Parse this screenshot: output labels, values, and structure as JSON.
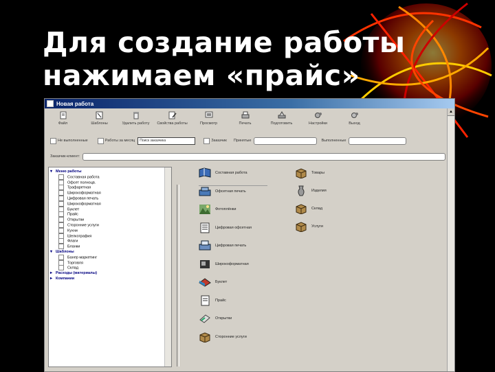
{
  "slide": {
    "title_line1": "Для создание работы",
    "title_line2": "нажимаем «прайс»"
  },
  "window": {
    "title": "Новая работа"
  },
  "toolbar": [
    {
      "label": "Файл",
      "icon": "file-icon"
    },
    {
      "label": "Шаблоны",
      "icon": "template-icon"
    },
    {
      "label": "Удалить работу",
      "icon": "trash-icon"
    },
    {
      "label": "Свойства работы",
      "icon": "edit-icon"
    },
    {
      "label": "Просмотр",
      "icon": "preview-icon"
    },
    {
      "label": "Печать",
      "icon": "printer-icon"
    },
    {
      "label": "Подготовить",
      "icon": "prepare-icon"
    },
    {
      "label": "Настройки",
      "icon": "settings-icon"
    },
    {
      "label": "Выход",
      "icon": "exit-icon"
    }
  ],
  "filters": {
    "check1": "Не выполненные",
    "check2": "Работы за месяц",
    "combo_value": "Поиск заказчика",
    "check3": "Заказчик",
    "label_status": "Принятые",
    "label_ready": "Выполненные",
    "customer_label": "Заказчик-клиент:"
  },
  "tree": {
    "group1": "Меню работы",
    "group1_items": [
      "Составная работа",
      "Офсет полноцв.",
      "Трафаретная",
      "Широкоформатная",
      "Цифровая печать",
      "Широкоформатная",
      "Буклет",
      "Прайс",
      "Открытки",
      "Сторонние услуги",
      "Кухни",
      "Шелкография",
      "Флаги",
      "Бланки"
    ],
    "group2": "Шаблоны",
    "group2_items": [
      "Банер маркетинг",
      "Торговля",
      "Склад"
    ],
    "group3": "Расходы (материалы)",
    "group4": "Компании"
  },
  "works": {
    "left": [
      {
        "label": "Составная работа",
        "icon": "book-icon"
      },
      {
        "label": "Офсетная печать",
        "icon": "offset-press-icon"
      },
      {
        "label": "Фотоплёнки",
        "icon": "photo-icon"
      },
      {
        "label": "Цифровая офсетная",
        "icon": "digital-offset-icon"
      },
      {
        "label": "Цифровая печать",
        "icon": "digital-print-icon"
      },
      {
        "label": "Широкоформатная",
        "icon": "wide-format-icon"
      },
      {
        "label": "Буклет",
        "icon": "booklet-icon"
      },
      {
        "label": "Прайс",
        "icon": "price-icon"
      },
      {
        "label": "Открытки",
        "icon": "postcard-icon"
      },
      {
        "label": "Сторонние услуги",
        "icon": "box-icon"
      }
    ],
    "right": [
      {
        "label": "Товары",
        "icon": "box-icon"
      },
      {
        "label": "Изделия",
        "icon": "vase-icon"
      },
      {
        "label": "Склад",
        "icon": "box-icon"
      },
      {
        "label": "Услуги",
        "icon": "box-icon"
      }
    ]
  },
  "colors": {
    "title_bar": "#0a246a",
    "window_bg": "#d4d0c8",
    "tree_group": "#000080"
  }
}
